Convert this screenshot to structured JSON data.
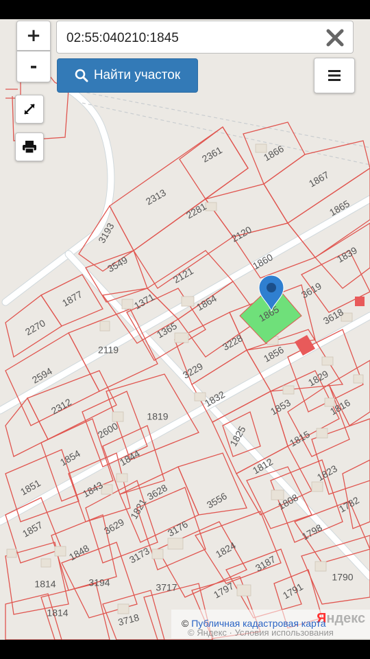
{
  "search": {
    "value": "02:55:040210:1845",
    "find_label": "Найти участок"
  },
  "controls": {
    "zoom_in": "+",
    "zoom_out": "-"
  },
  "icons": {
    "zoom_in": "plus-icon",
    "zoom_out": "minus-icon",
    "fullscreen": "expand-icon",
    "print": "printer-icon",
    "clear": "close-icon",
    "find": "search-icon",
    "menu": "menu-icon",
    "marker": "map-pin-icon"
  },
  "colors": {
    "plot_border": "#e0554f",
    "selected_plot": "#6fe07a",
    "highlight_plot": "#e85a5a",
    "marker": "#2f7fd0",
    "button_primary": "#337ab7"
  },
  "map": {
    "selected_plot": "1845",
    "plot_labels": [
      "2361",
      "1866",
      "1867",
      "2313",
      "2281",
      "1865",
      "3193",
      "2120",
      "3549",
      "1860",
      "1839",
      "2121",
      "1877",
      "1371",
      "1864",
      "3619",
      "1865",
      "2270",
      "1365",
      "3618",
      "2119",
      "3228",
      "1856",
      "2594",
      "3229",
      "1829",
      "2312",
      "1832",
      "1853",
      "1816",
      "2600",
      "1819",
      "1825",
      "1815",
      "1854",
      "1844",
      "1812",
      "1851",
      "1843",
      "3628",
      "1823",
      "3556",
      "1808",
      "1782",
      "1857",
      "3629",
      "1821",
      "3176",
      "1798",
      "1848",
      "3173",
      "1824",
      "1814",
      "3194",
      "3717",
      "1797",
      "3187",
      "1790",
      "1791",
      "1814",
      "3718"
    ],
    "attribution": {
      "logo_first": "Я",
      "logo_rest": "ндекс",
      "terms": "© Яндекс · Условия использования",
      "copyright_symbol": "©",
      "copyright_link": "Публичная кадастровая карта"
    }
  }
}
